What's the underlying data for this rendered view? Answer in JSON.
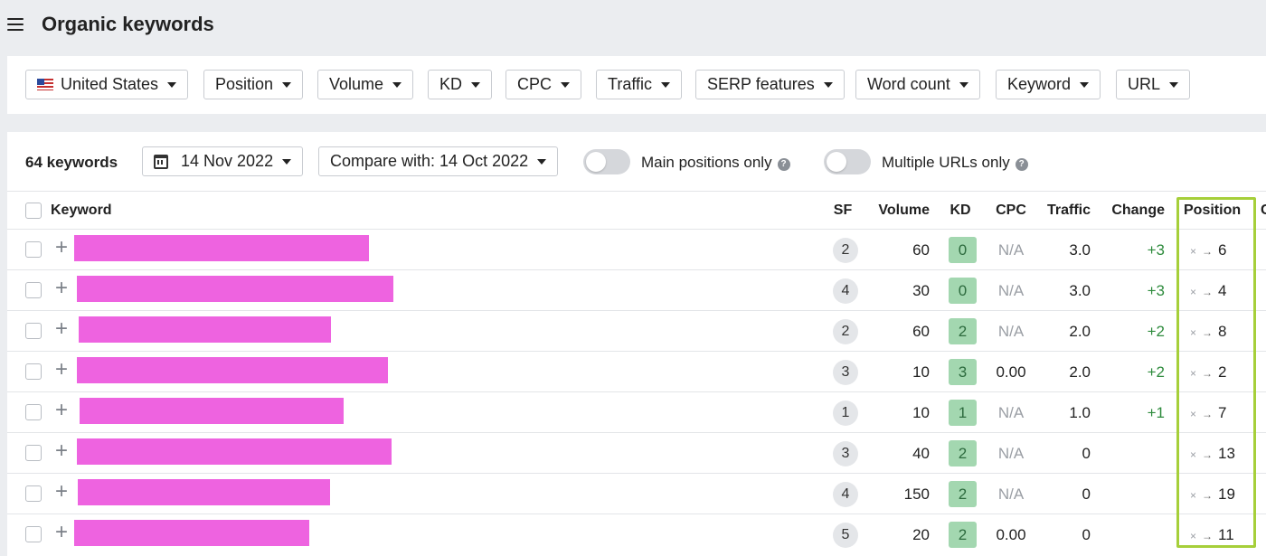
{
  "header": {
    "title": "Organic keywords",
    "menu_icon": "hamburger-icon"
  },
  "filters": [
    {
      "label": "United States",
      "icon": "us-flag-icon"
    },
    {
      "label": "Position"
    },
    {
      "label": "Volume"
    },
    {
      "label": "KD"
    },
    {
      "label": "CPC"
    },
    {
      "label": "Traffic"
    },
    {
      "label": "SERP features"
    },
    {
      "label": "Word count"
    },
    {
      "label": "Keyword"
    },
    {
      "label": "URL"
    }
  ],
  "toolbar": {
    "count": "64 keywords",
    "date": "14 Nov 2022",
    "compare": "Compare with: 14 Oct 2022",
    "main_positions": "Main positions only",
    "multiple_urls": "Multiple URLs only",
    "main_positions_on": false,
    "multiple_urls_on": false
  },
  "columns": {
    "keyword": "Keyword",
    "sf": "SF",
    "volume": "Volume",
    "kd": "KD",
    "cpc": "CPC",
    "traffic": "Traffic",
    "change": "Change",
    "position": "Position",
    "next": "C"
  },
  "rows": [
    {
      "sf": "2",
      "volume": "60",
      "kd": "0",
      "cpc": "N/A",
      "traffic": "3.0",
      "change": "+3",
      "pos_from": "×",
      "pos_to": "6"
    },
    {
      "sf": "4",
      "volume": "30",
      "kd": "0",
      "cpc": "N/A",
      "traffic": "3.0",
      "change": "+3",
      "pos_from": "×",
      "pos_to": "4"
    },
    {
      "sf": "2",
      "volume": "60",
      "kd": "2",
      "cpc": "N/A",
      "traffic": "2.0",
      "change": "+2",
      "pos_from": "×",
      "pos_to": "8"
    },
    {
      "sf": "3",
      "volume": "10",
      "kd": "3",
      "cpc": "0.00",
      "traffic": "2.0",
      "change": "+2",
      "pos_from": "×",
      "pos_to": "2"
    },
    {
      "sf": "1",
      "volume": "10",
      "kd": "1",
      "cpc": "N/A",
      "traffic": "1.0",
      "change": "+1",
      "pos_from": "×",
      "pos_to": "7"
    },
    {
      "sf": "3",
      "volume": "40",
      "kd": "2",
      "cpc": "N/A",
      "traffic": "0",
      "change": "",
      "pos_from": "×",
      "pos_to": "13"
    },
    {
      "sf": "4",
      "volume": "150",
      "kd": "2",
      "cpc": "N/A",
      "traffic": "0",
      "change": "",
      "pos_from": "×",
      "pos_to": "19"
    },
    {
      "sf": "5",
      "volume": "20",
      "kd": "2",
      "cpc": "0.00",
      "traffic": "0",
      "change": "",
      "pos_from": "×",
      "pos_to": "11"
    }
  ],
  "colors": {
    "redaction": "#ee63e0",
    "kd_badge": "#a3d7b0",
    "highlight": "#a6cf3a",
    "positive_change": "#2e8b3d"
  },
  "arrow_glyph": "→"
}
